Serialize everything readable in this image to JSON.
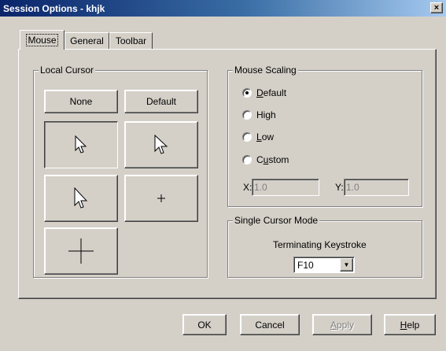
{
  "window": {
    "title": "Session Options - khjk",
    "close_glyph": "×"
  },
  "tabs": [
    {
      "label": "Mouse",
      "active": true
    },
    {
      "label": "General",
      "active": false
    },
    {
      "label": "Toolbar",
      "active": false
    }
  ],
  "local_cursor": {
    "title": "Local Cursor",
    "none_label": "None",
    "default_label": "Default",
    "cursor_options": [
      "arrow-icon",
      "arrow-large-icon",
      "arrow-alt-icon",
      "small-cross-icon",
      "large-cross-icon"
    ],
    "selected": "arrow-icon"
  },
  "mouse_scaling": {
    "title": "Mouse Scaling",
    "options": [
      {
        "pre": "",
        "ul": "D",
        "post": "efault",
        "checked": true
      },
      {
        "pre": "Hi",
        "ul": "g",
        "post": "h",
        "checked": false
      },
      {
        "pre": "",
        "ul": "L",
        "post": "ow",
        "checked": false
      },
      {
        "pre": "C",
        "ul": "u",
        "post": "stom",
        "checked": false
      }
    ],
    "x_label": "X:",
    "x_value": "1.0",
    "y_label": "Y:",
    "y_value": "1.0"
  },
  "single_cursor": {
    "title": "Single Cursor Mode",
    "keystroke_label": "Terminating Keystroke",
    "keystroke_value": "F10"
  },
  "footer": {
    "ok_label": "OK",
    "cancel_label": "Cancel",
    "apply": {
      "ul": "A",
      "post": "pply"
    },
    "help": {
      "ul": "H",
      "post": "elp"
    }
  },
  "colors": {
    "face": "#d4d0c8",
    "title_start": "#0a246a",
    "title_end": "#a6caf0"
  }
}
